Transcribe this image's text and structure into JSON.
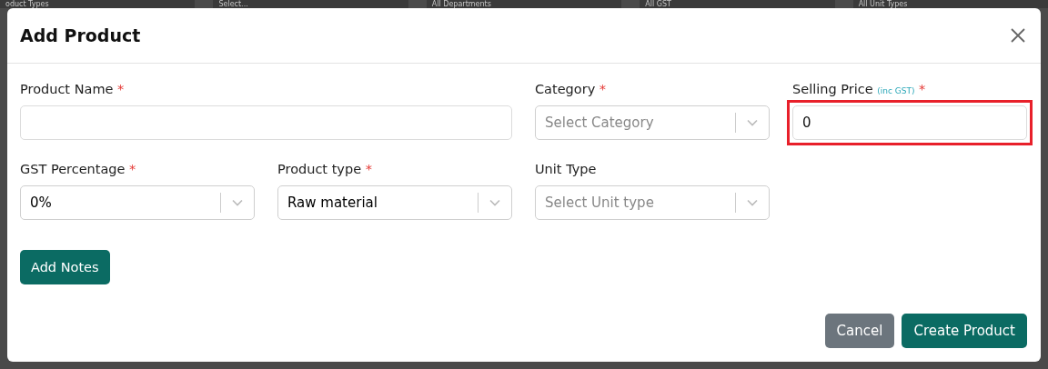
{
  "background": {
    "filters": [
      {
        "value": "oduct Types"
      },
      {
        "value": "Select..."
      },
      {
        "value": "All Departments"
      },
      {
        "value": "All GST"
      },
      {
        "value": "All Unit Types"
      }
    ]
  },
  "dialog": {
    "title": "Add Product",
    "fields": [
      {
        "kind": "text",
        "label": "Product Name",
        "required_mark": "*",
        "highlighted": false
      },
      {
        "kind": "select",
        "label": "Category",
        "required_mark": "*",
        "placeholder": "Select Category"
      },
      {
        "kind": "text",
        "label": "Selling Price",
        "note": "(inc GST)",
        "required_mark": "*",
        "value": "0",
        "highlighted": true
      },
      {
        "kind": "select",
        "label": "GST Percentage",
        "required_mark": "*",
        "value": "0%"
      },
      {
        "kind": "select",
        "label": "Product type",
        "required_mark": "*",
        "value": "Raw material"
      },
      {
        "kind": "select",
        "label": "Unit Type",
        "placeholder": "Select Unit type"
      }
    ],
    "notes_button": "Add Notes",
    "buttons": [
      {
        "kind": "secondary",
        "label": "Cancel"
      },
      {
        "kind": "primary",
        "label": "Create Product"
      }
    ]
  }
}
